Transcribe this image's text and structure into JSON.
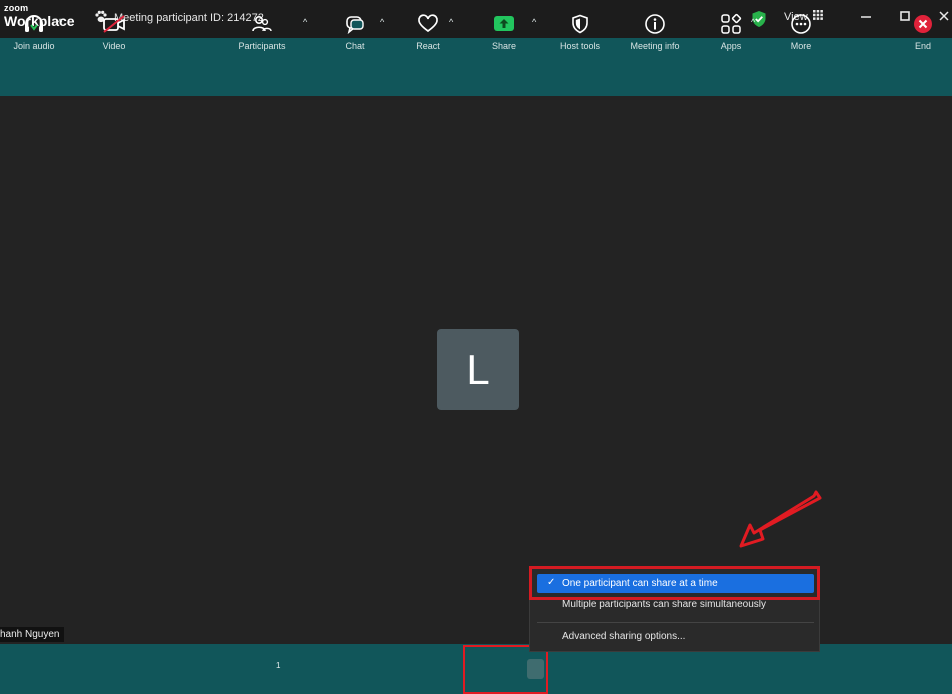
{
  "titlebar": {
    "logo_small": "zoom",
    "logo_big": "Workplace",
    "meeting_id": "Meeting participant ID: 214272",
    "view_label": "View"
  },
  "stage": {
    "avatar_initial": "L",
    "name_tag": "hanh Nguyen"
  },
  "toolbar": {
    "items": [
      {
        "label": "Join audio",
        "icon": "headphones-icon"
      },
      {
        "label": "Video",
        "icon": "video-off-icon"
      },
      {
        "label": "Participants",
        "icon": "participants-icon",
        "count": "1"
      },
      {
        "label": "Chat",
        "icon": "chat-icon"
      },
      {
        "label": "React",
        "icon": "heart-icon"
      },
      {
        "label": "Share",
        "icon": "share-screen-icon"
      },
      {
        "label": "Host tools",
        "icon": "shield-icon"
      },
      {
        "label": "Meeting info",
        "icon": "info-icon"
      },
      {
        "label": "Apps",
        "icon": "apps-icon"
      },
      {
        "label": "More",
        "icon": "more-icon"
      },
      {
        "label": "End",
        "icon": "end-icon"
      }
    ]
  },
  "share_menu": {
    "options": [
      {
        "label": "One participant can share at a time",
        "checked": true
      },
      {
        "label": "Multiple participants can share simultaneously",
        "checked": false
      },
      {
        "label": "Advanced sharing options...",
        "checked": false
      }
    ]
  },
  "colors": {
    "teal": "#11565a",
    "stage": "#232323",
    "highlight": "#1a6fe0",
    "annotation_red": "#e11b22",
    "share_green": "#22c55e",
    "end_red": "#e0223a"
  }
}
